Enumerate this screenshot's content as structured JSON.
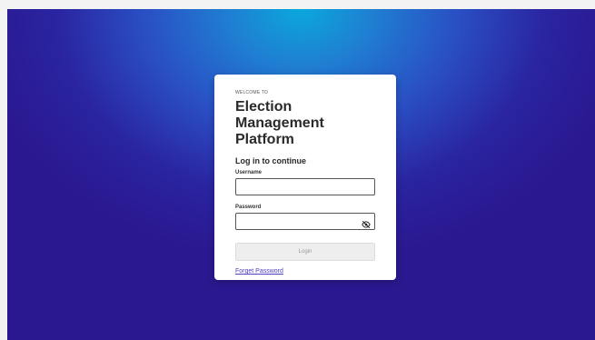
{
  "colors": {
    "background_top": "#0aa8dc",
    "background_bottom": "#2a1890",
    "card": "#ffffff",
    "link": "#4b3fc4"
  },
  "login": {
    "welcome": "WELCOME TO",
    "title": "Election Management Platform",
    "subtitle": "Log in to continue",
    "username_label": "Username",
    "username_value": "",
    "password_label": "Password",
    "password_value": "",
    "password_toggle_icon": "eye-off-icon",
    "login_button": "Login",
    "forgot_link": "Forget Password"
  }
}
